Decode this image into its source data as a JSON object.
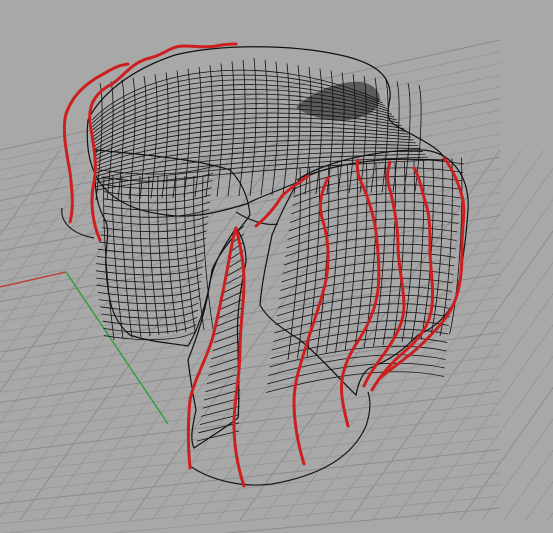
{
  "viewport": {
    "background": "#a8a8a8",
    "grid_color": "#989898",
    "x_axis_color": "#c0392b",
    "y_axis_color": "#2e9e3a"
  },
  "model": {
    "surface_fill_light": "#f2f2f2",
    "surface_fill_dark": "#4a4a4a",
    "mesh_color": "#111111",
    "section_curve_color": "#cc1f1f"
  },
  "icons": {
    "x_axis": "x-axis-line",
    "y_axis": "y-axis-line"
  }
}
